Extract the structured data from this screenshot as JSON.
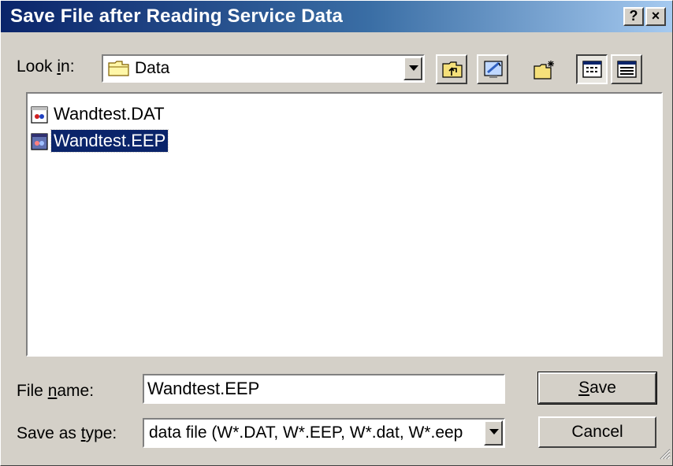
{
  "window": {
    "title": "Save File after Reading Service Data",
    "help_label": "?",
    "close_label": "×"
  },
  "lookin": {
    "label_pre": "Look ",
    "label_key": "i",
    "label_post": "n:",
    "value": "Data",
    "folder_icon": "folder-icon"
  },
  "toolbar": {
    "icons": [
      "up-one-level-icon",
      "desktop-icon",
      "new-folder-icon",
      "list-view-icon",
      "details-view-icon"
    ]
  },
  "files": [
    {
      "name": "Wandtest.DAT",
      "selected": false
    },
    {
      "name": "Wandtest.EEP",
      "selected": true
    }
  ],
  "filename": {
    "label_pre": "File ",
    "label_key": "n",
    "label_post": "ame:",
    "value": "Wandtest.EEP"
  },
  "savetype": {
    "label_pre": "Save as ",
    "label_key": "t",
    "label_post": "ype:",
    "value": "data file (W*.DAT, W*.EEP, W*.dat, W*.eep"
  },
  "buttons": {
    "save_key": "S",
    "save_rest": "ave",
    "cancel": "Cancel"
  },
  "colors": {
    "title_active": "#0a246a",
    "selection": "#0a246a",
    "face": "#d4d0c8"
  }
}
